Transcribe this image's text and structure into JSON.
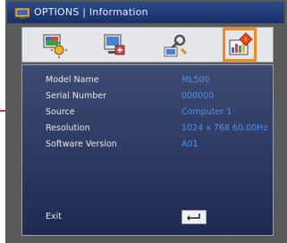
{
  "window": {
    "title": "OPTIONS | Information"
  },
  "tabs": [
    {
      "icon": "display-adjust-icon",
      "active": false
    },
    {
      "icon": "screen-setup-icon",
      "active": false
    },
    {
      "icon": "settings-tools-icon",
      "active": false
    },
    {
      "icon": "information-icon",
      "active": true
    }
  ],
  "info": {
    "rows": [
      {
        "label": "Model Name",
        "value": "ML500"
      },
      {
        "label": "Serial Number",
        "value": "000000"
      },
      {
        "label": "Source",
        "value": "Computer 1"
      },
      {
        "label": "Resolution",
        "value": "1024 x 768 60.00Hz"
      },
      {
        "label": "Software Version",
        "value": "A01"
      }
    ]
  },
  "footer": {
    "exit_label": "Exit",
    "enter_icon": "enter-key-icon"
  },
  "colors": {
    "accent": "#f08a1a",
    "value_text": "#4f8ff0",
    "title_bar": "#1f3a78"
  }
}
